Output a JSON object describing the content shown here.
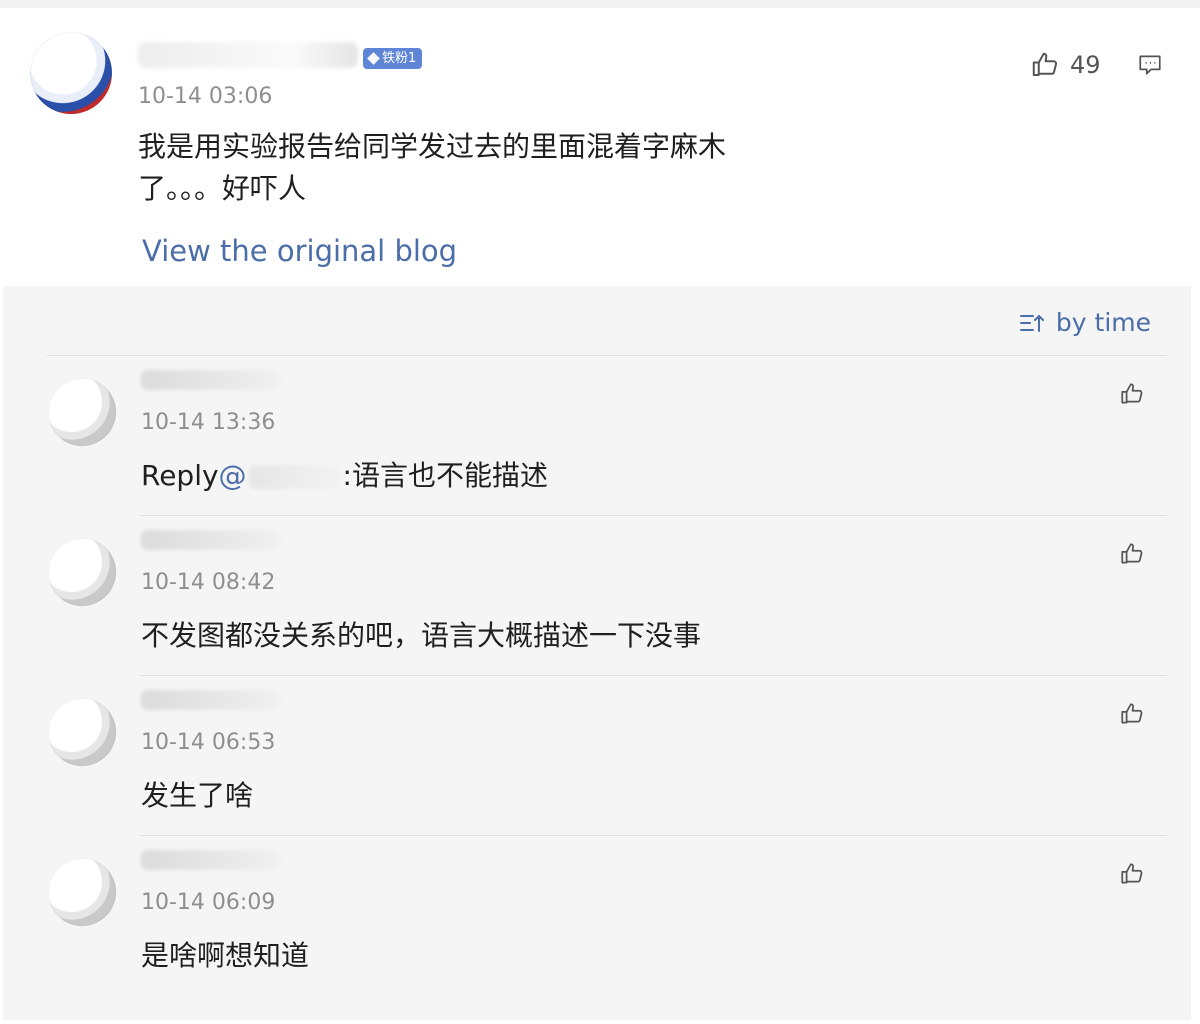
{
  "main_comment": {
    "badge_label": "铁粉1",
    "timestamp": "10-14 03:06",
    "like_count": "49",
    "content": "我是用实验报告给同学发过去的里面混着字麻木了。。。好吓人",
    "view_original_label": "View the original blog"
  },
  "replies_panel": {
    "sort_label": "by time",
    "replies": [
      {
        "timestamp": "10-14 13:36",
        "content_prefix": "Reply",
        "mention_symbol": "@",
        "content_suffix": ":语言也不能描述"
      },
      {
        "timestamp": "10-14 08:42",
        "content": "不发图都没关系的吧，语言大概描述一下没事"
      },
      {
        "timestamp": "10-14 06:53",
        "content": "发生了啥"
      },
      {
        "timestamp": "10-14 06:09",
        "content": "是啥啊想知道"
      }
    ]
  },
  "colors": {
    "link_blue": "#4b6ea8",
    "badge_blue": "#5f86d6",
    "timestamp_gray": "#8f8f8f",
    "panel_bg": "#f5f5f5"
  },
  "icons": {
    "like": "thumbs-up-icon",
    "comment": "comment-icon",
    "sort": "sort-icon"
  }
}
